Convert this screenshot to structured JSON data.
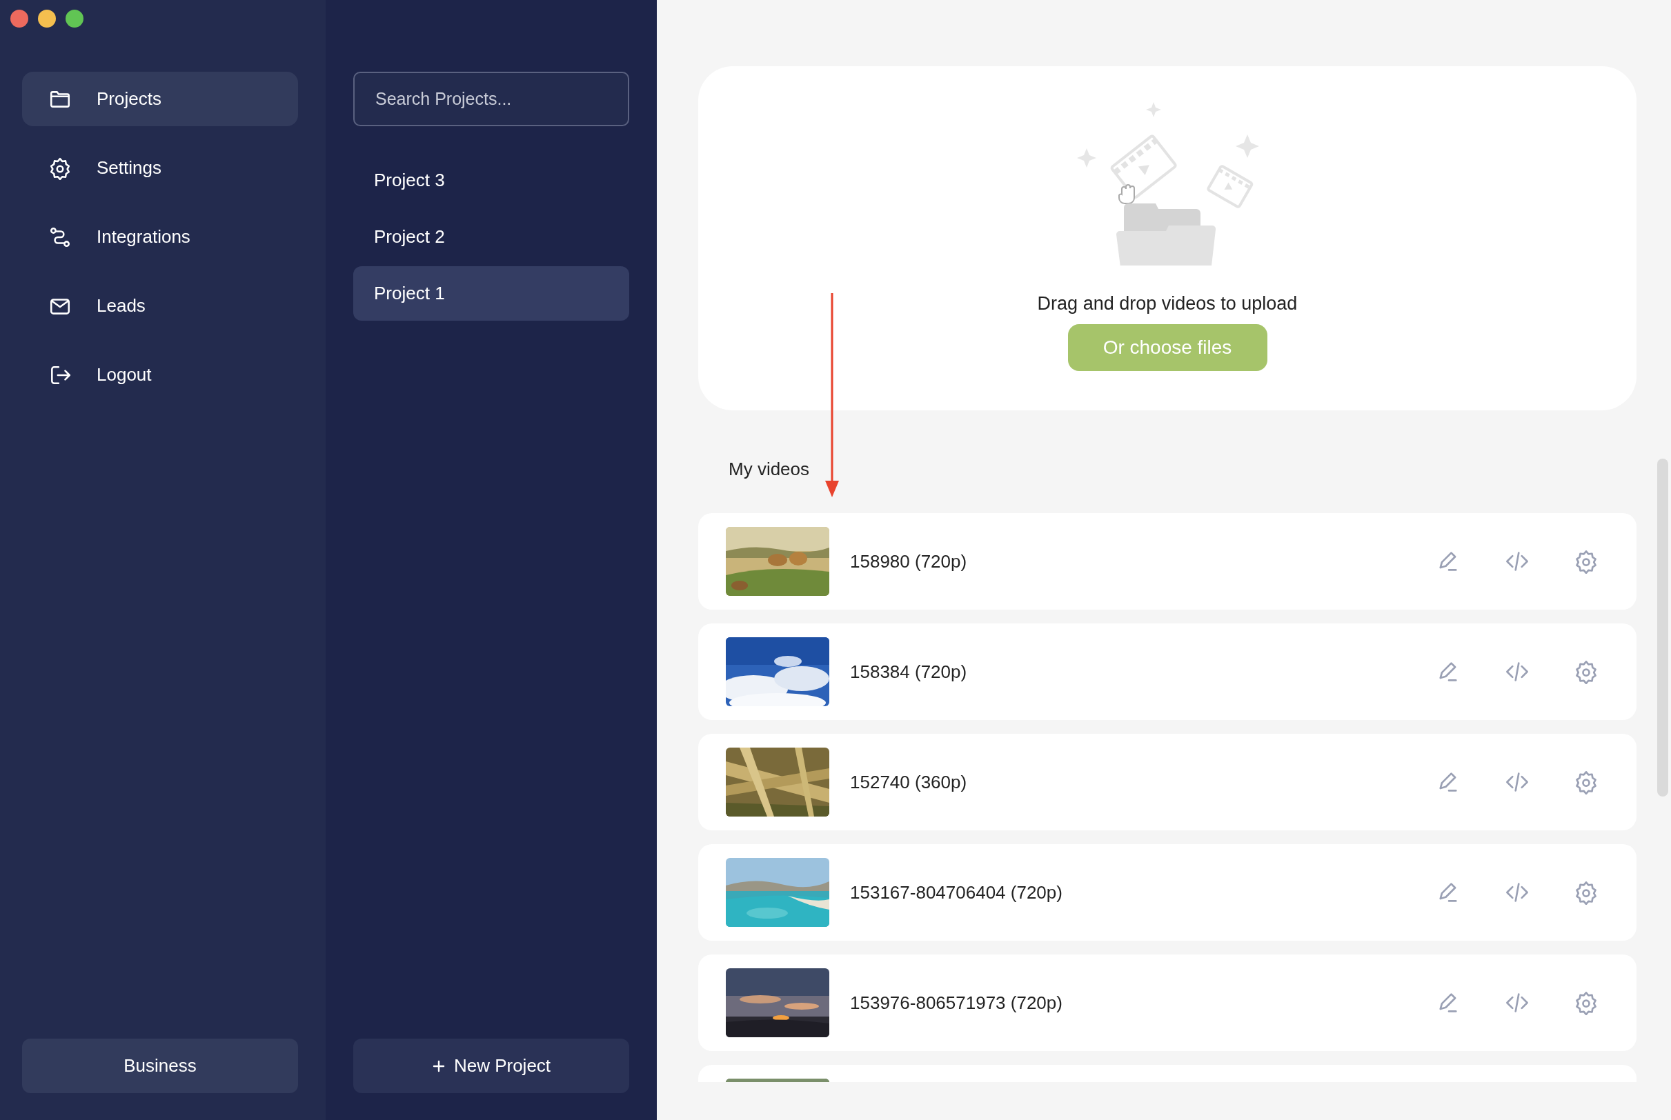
{
  "nav": {
    "items": [
      {
        "label": "Projects",
        "selected": true
      },
      {
        "label": "Settings",
        "selected": false
      },
      {
        "label": "Integrations",
        "selected": false
      },
      {
        "label": "Leads",
        "selected": false
      },
      {
        "label": "Logout",
        "selected": false
      }
    ],
    "plan_button": "Business"
  },
  "projects": {
    "search": {
      "placeholder": "Search Projects..."
    },
    "items": [
      {
        "label": "Project 3",
        "selected": false
      },
      {
        "label": "Project 2",
        "selected": false
      },
      {
        "label": "Project 1",
        "selected": true
      }
    ],
    "new_button": "New Project"
  },
  "upload": {
    "prompt": "Drag and drop videos to upload",
    "button": "Or choose files"
  },
  "videos": {
    "title": "My videos",
    "items": [
      {
        "title": "158980 (720p)"
      },
      {
        "title": "158384 (720p)"
      },
      {
        "title": "152740 (360p)"
      },
      {
        "title": "153167-804706404 (720p)"
      },
      {
        "title": "153976-806571973 (720p)"
      },
      {
        "kind": "picture"
      }
    ]
  }
}
